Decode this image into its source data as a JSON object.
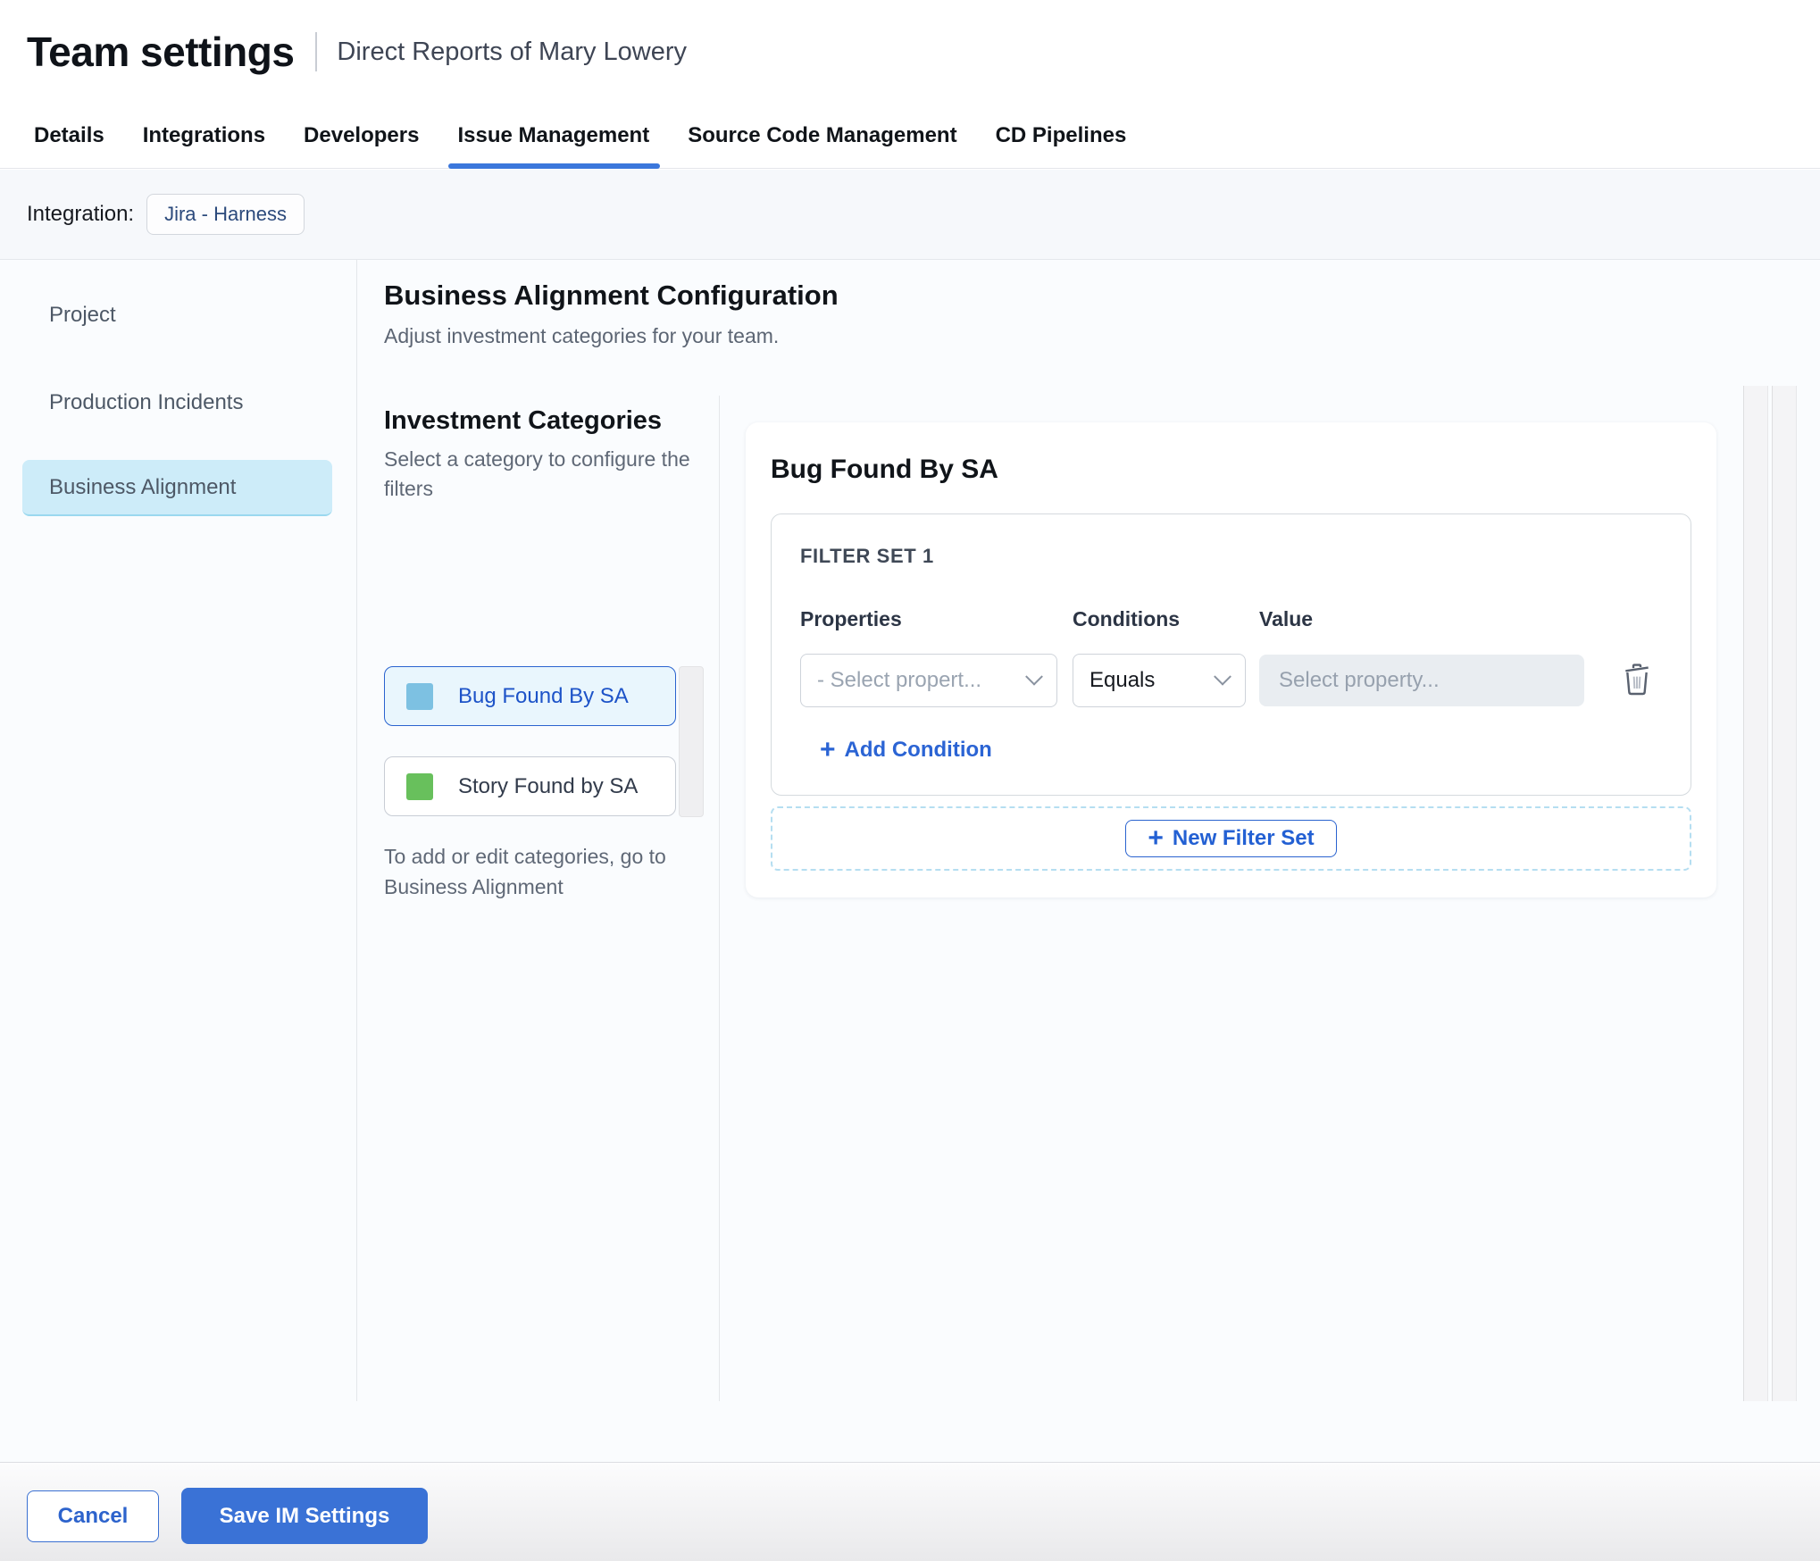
{
  "header": {
    "title": "Team settings",
    "subtitle": "Direct Reports of Mary Lowery"
  },
  "tabs": {
    "items": [
      {
        "label": "Details",
        "active": false
      },
      {
        "label": "Integrations",
        "active": false
      },
      {
        "label": "Developers",
        "active": false
      },
      {
        "label": "Issue Management",
        "active": true
      },
      {
        "label": "Source Code Management",
        "active": false
      },
      {
        "label": "CD Pipelines",
        "active": false
      }
    ]
  },
  "integration": {
    "label": "Integration:",
    "chip": "Jira - Harness"
  },
  "sidebar": {
    "items": [
      {
        "label": "Project",
        "selected": false
      },
      {
        "label": "Production Incidents",
        "selected": false
      },
      {
        "label": "Business Alignment",
        "selected": true
      }
    ]
  },
  "main": {
    "title": "Business Alignment Configuration",
    "subtitle": "Adjust investment categories for your team.",
    "categories": {
      "heading": "Investment Categories",
      "hint": "Select a category to configure the filters",
      "items": [
        {
          "label": "Bug Found By SA",
          "color": "#7DC1E2",
          "selected": true
        },
        {
          "label": "Story Found by SA",
          "color": "#68C05C",
          "selected": false
        }
      ],
      "footnote": "To add or edit categories, go to Business Alignment"
    },
    "panel": {
      "title": "Bug Found By SA",
      "filter_set": {
        "heading": "FILTER SET 1",
        "columns": {
          "properties": "Properties",
          "conditions": "Conditions",
          "value": "Value"
        },
        "property_placeholder": "- Select propert...",
        "condition_value": "Equals",
        "value_placeholder": "Select property...",
        "add_condition_label": "Add Condition"
      },
      "new_filter_set_label": "New Filter Set"
    }
  },
  "footer": {
    "cancel_label": "Cancel",
    "save_label": "Save IM Settings"
  },
  "icons": {
    "plus": "+"
  },
  "colors": {
    "primary_blue": "#2F6BD6",
    "tab_underline": "#3B77DC",
    "save_button_bg": "#3A72D6",
    "sidebar_selected_bg": "#CDECF9",
    "category_selected_bg": "#E9F6FD",
    "category_swatch_blue": "#7DC1E2",
    "category_swatch_green": "#68C05C",
    "value_input_bg": "#E9EDF1",
    "dashed_border": "#B5DEF1"
  }
}
